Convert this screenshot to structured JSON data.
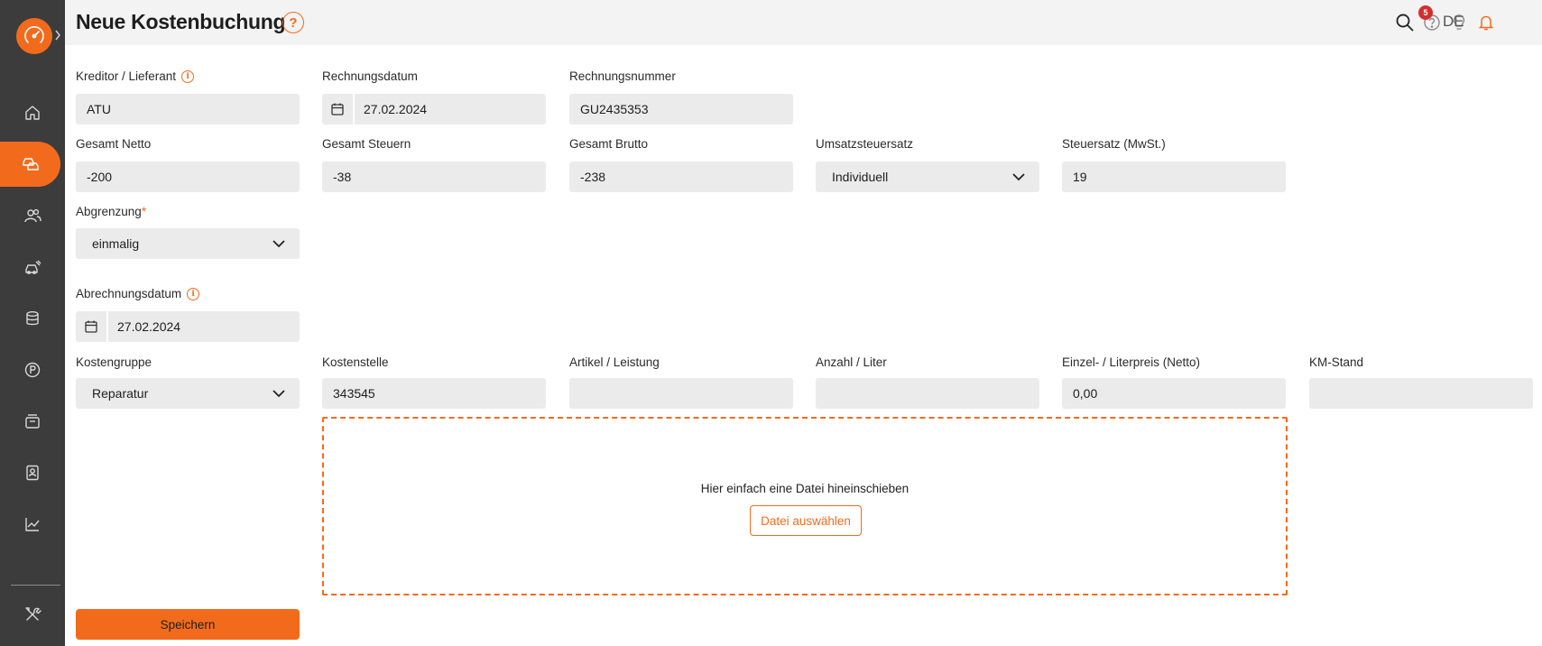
{
  "header": {
    "title": "Neue Kostenbuchung",
    "help_symbol": "?",
    "notification_count": "5",
    "language": "DE"
  },
  "sidebar": {
    "items": [
      {
        "icon": "home-icon",
        "active": false
      },
      {
        "icon": "car-stack-icon",
        "active": true
      },
      {
        "icon": "users-icon",
        "active": false
      },
      {
        "icon": "car-service-icon",
        "active": false
      },
      {
        "icon": "coins-icon",
        "active": false
      },
      {
        "icon": "parking-icon",
        "active": false
      },
      {
        "icon": "calendar-stack-icon",
        "active": false
      },
      {
        "icon": "contact-card-icon",
        "active": false
      },
      {
        "icon": "chart-icon",
        "active": false
      },
      {
        "icon": "tools-icon",
        "active": false
      }
    ]
  },
  "form": {
    "kreditor": {
      "label": "Kreditor / Lieferant",
      "value": "ATU"
    },
    "rechnungsdatum": {
      "label": "Rechnungsdatum",
      "value": "27.02.2024"
    },
    "rechnungsnummer": {
      "label": "Rechnungsnummer",
      "value": "GU2435353"
    },
    "gesamt_netto": {
      "label": "Gesamt Netto",
      "value": "-200"
    },
    "gesamt_steuern": {
      "label": "Gesamt Steuern",
      "value": "-38"
    },
    "gesamt_brutto": {
      "label": "Gesamt Brutto",
      "value": "-238"
    },
    "umsatzsteuersatz": {
      "label": "Umsatzsteuersatz",
      "value": "Individuell"
    },
    "steuersatz": {
      "label": "Steuersatz (MwSt.)",
      "value": "19"
    },
    "abgrenzung": {
      "label": "Abgrenzung",
      "required_mark": "*",
      "value": "einmalig"
    },
    "abrechnungsdatum": {
      "label": "Abrechnungsdatum",
      "value": "27.02.2024"
    },
    "kostengruppe": {
      "label": "Kostengruppe",
      "value": "Reparatur"
    },
    "kostenstelle": {
      "label": "Kostenstelle",
      "value": "343545"
    },
    "artikel": {
      "label": "Artikel / Leistung",
      "value": ""
    },
    "anzahl": {
      "label": "Anzahl / Liter",
      "value": ""
    },
    "einzelpreis": {
      "label": "Einzel- / Literpreis (Netto)",
      "value": "0,00"
    },
    "km_stand": {
      "label": "KM-Stand",
      "value": ""
    }
  },
  "dropzone": {
    "text": "Hier einfach eine Datei hineinschieben",
    "button_label": "Datei auswählen"
  },
  "actions": {
    "save_label": "Speichern"
  },
  "colors": {
    "accent": "#f26b1d",
    "sidebar": "#3c3c3c",
    "field": "#ebebeb",
    "badge": "#d32f2f"
  }
}
